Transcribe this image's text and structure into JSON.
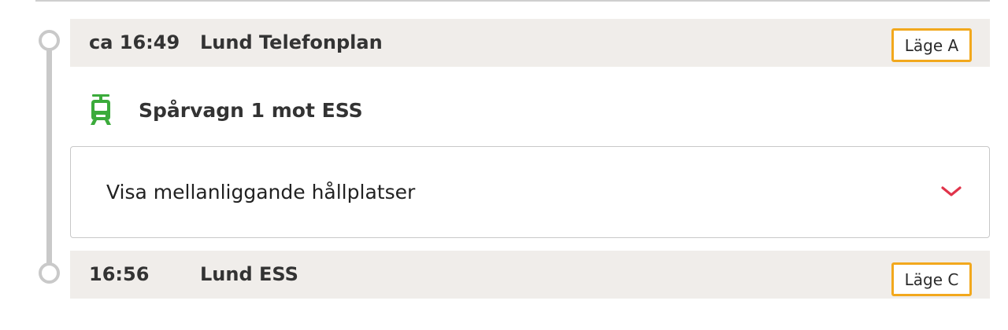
{
  "trip": {
    "departure": {
      "time": "ca 16:49",
      "stop_name": "Lund Telefonplan",
      "platform": "Läge A"
    },
    "line": {
      "label": "Spårvagn 1 mot ESS",
      "icon": "tram-icon",
      "color": "#3bab3b"
    },
    "intermediate_stops": {
      "toggle_label": "Visa mellanliggande hållplatser",
      "icon": "chevron-down-icon",
      "icon_color": "#e0334a"
    },
    "arrival": {
      "time": "16:56",
      "stop_name": "Lund ESS",
      "platform": "Läge C"
    },
    "colors": {
      "platform_badge_border": "#f2a81d",
      "stop_row_background": "#f0edea",
      "timeline": "#c9c9c9"
    }
  }
}
